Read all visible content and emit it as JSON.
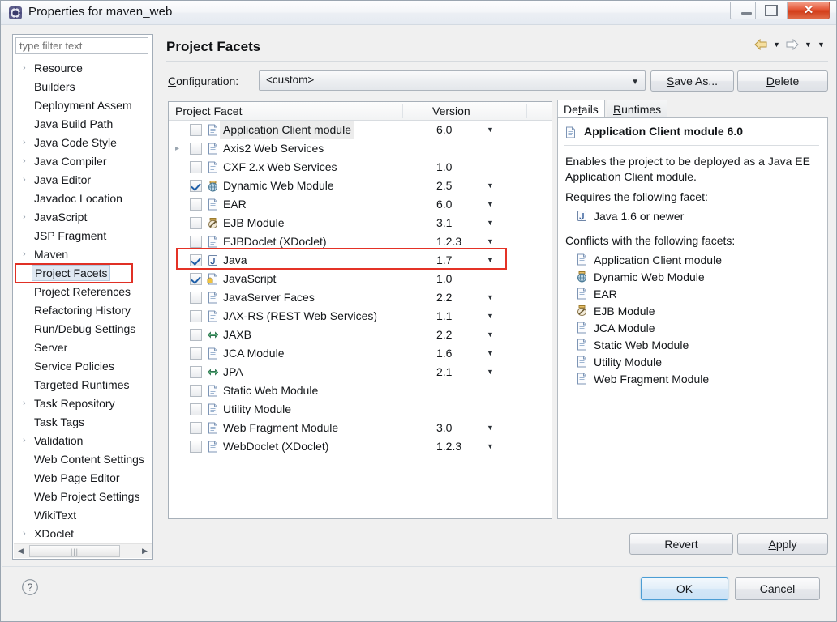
{
  "window": {
    "title": "Properties for maven_web",
    "icon": "eclipse-properties-icon",
    "controls": {
      "minimize": "–",
      "maximize": "□",
      "close": "✕"
    }
  },
  "sidebar": {
    "filter_placeholder": "type filter text",
    "filter_value": "",
    "selected": "Project Facets",
    "items": [
      {
        "label": "Resource",
        "expandable": true
      },
      {
        "label": "Builders",
        "expandable": false
      },
      {
        "label": "Deployment Assem",
        "expandable": false
      },
      {
        "label": "Java Build Path",
        "expandable": false
      },
      {
        "label": "Java Code Style",
        "expandable": true
      },
      {
        "label": "Java Compiler",
        "expandable": true
      },
      {
        "label": "Java Editor",
        "expandable": true
      },
      {
        "label": "Javadoc Location",
        "expandable": false
      },
      {
        "label": "JavaScript",
        "expandable": true
      },
      {
        "label": "JSP Fragment",
        "expandable": false
      },
      {
        "label": "Maven",
        "expandable": true
      },
      {
        "label": "Project Facets",
        "expandable": false
      },
      {
        "label": "Project References",
        "expandable": false
      },
      {
        "label": "Refactoring History",
        "expandable": false
      },
      {
        "label": "Run/Debug Settings",
        "expandable": false
      },
      {
        "label": "Server",
        "expandable": false
      },
      {
        "label": "Service Policies",
        "expandable": false
      },
      {
        "label": "Targeted Runtimes",
        "expandable": false
      },
      {
        "label": "Task Repository",
        "expandable": true
      },
      {
        "label": "Task Tags",
        "expandable": false
      },
      {
        "label": "Validation",
        "expandable": true
      },
      {
        "label": "Web Content Settings",
        "expandable": false
      },
      {
        "label": "Web Page Editor",
        "expandable": false
      },
      {
        "label": "Web Project Settings",
        "expandable": false
      },
      {
        "label": "WikiText",
        "expandable": false
      },
      {
        "label": "XDoclet",
        "expandable": true
      }
    ]
  },
  "page": {
    "title": "Project Facets",
    "nav": {
      "back_icon": "back-arrow-icon",
      "back_menu_icon": "chevron-down-icon",
      "forward_icon": "forward-arrow-icon",
      "forward_menu_icon": "chevron-down-icon",
      "menu_icon": "chevron-down-icon"
    }
  },
  "configuration": {
    "label": "Configuration:",
    "label_mnemonic": "C",
    "value": "<custom>",
    "dropdown_icon": "chevron-down-icon",
    "save_as_label": "Save As...",
    "save_as_mnemonic": "S",
    "delete_label": "Delete",
    "delete_mnemonic": "D"
  },
  "facets_table": {
    "columns": [
      "Project Facet",
      "Version"
    ],
    "rows": [
      {
        "name": "Application Client module",
        "version": "6.0",
        "checked": false,
        "has_dropdown": true,
        "expandable": false,
        "highlighted": true,
        "icon": "document-icon"
      },
      {
        "name": "Axis2 Web Services",
        "version": "",
        "checked": false,
        "has_dropdown": false,
        "expandable": true,
        "highlighted": false,
        "icon": "document-icon"
      },
      {
        "name": "CXF 2.x Web Services",
        "version": "1.0",
        "checked": false,
        "has_dropdown": false,
        "expandable": false,
        "highlighted": false,
        "icon": "document-icon"
      },
      {
        "name": "Dynamic Web Module",
        "version": "2.5",
        "checked": true,
        "has_dropdown": true,
        "expandable": false,
        "highlighted": false,
        "icon": "web-module-icon"
      },
      {
        "name": "EAR",
        "version": "6.0",
        "checked": false,
        "has_dropdown": true,
        "expandable": false,
        "highlighted": false,
        "icon": "document-icon"
      },
      {
        "name": "EJB Module",
        "version": "3.1",
        "checked": false,
        "has_dropdown": true,
        "expandable": false,
        "highlighted": false,
        "icon": "ejb-module-icon"
      },
      {
        "name": "EJBDoclet (XDoclet)",
        "version": "1.2.3",
        "checked": false,
        "has_dropdown": true,
        "expandable": false,
        "highlighted": false,
        "icon": "document-icon"
      },
      {
        "name": "Java",
        "version": "1.7",
        "checked": true,
        "has_dropdown": true,
        "expandable": false,
        "highlighted": false,
        "icon": "java-icon"
      },
      {
        "name": "JavaScript",
        "version": "1.0",
        "checked": true,
        "has_dropdown": false,
        "expandable": false,
        "highlighted": false,
        "icon": "javascript-icon"
      },
      {
        "name": "JavaServer Faces",
        "version": "2.2",
        "checked": false,
        "has_dropdown": true,
        "expandable": false,
        "highlighted": false,
        "icon": "document-icon"
      },
      {
        "name": "JAX-RS (REST Web Services)",
        "version": "1.1",
        "checked": false,
        "has_dropdown": true,
        "expandable": false,
        "highlighted": false,
        "icon": "document-icon"
      },
      {
        "name": "JAXB",
        "version": "2.2",
        "checked": false,
        "has_dropdown": true,
        "expandable": false,
        "highlighted": false,
        "icon": "jaxb-icon"
      },
      {
        "name": "JCA Module",
        "version": "1.6",
        "checked": false,
        "has_dropdown": true,
        "expandable": false,
        "highlighted": false,
        "icon": "document-icon"
      },
      {
        "name": "JPA",
        "version": "2.1",
        "checked": false,
        "has_dropdown": true,
        "expandable": false,
        "highlighted": false,
        "icon": "jpa-icon"
      },
      {
        "name": "Static Web Module",
        "version": "",
        "checked": false,
        "has_dropdown": false,
        "expandable": false,
        "highlighted": false,
        "icon": "document-icon"
      },
      {
        "name": "Utility Module",
        "version": "",
        "checked": false,
        "has_dropdown": false,
        "expandable": false,
        "highlighted": false,
        "icon": "document-icon"
      },
      {
        "name": "Web Fragment Module",
        "version": "3.0",
        "checked": false,
        "has_dropdown": true,
        "expandable": false,
        "highlighted": false,
        "icon": "document-icon"
      },
      {
        "name": "WebDoclet (XDoclet)",
        "version": "1.2.3",
        "checked": false,
        "has_dropdown": true,
        "expandable": false,
        "highlighted": false,
        "icon": "document-icon"
      }
    ]
  },
  "details": {
    "tabs": [
      {
        "label": "Details",
        "mnemonic": "t",
        "active": true
      },
      {
        "label": "Runtimes",
        "mnemonic": "R",
        "active": false
      }
    ],
    "header": "Application Client module 6.0",
    "header_icon": "document-icon",
    "description": "Enables the project to be deployed as a Java EE Application Client module.",
    "requires_label": "Requires the following facet:",
    "requires": [
      {
        "label": "Java 1.6 or newer",
        "icon": "java-icon"
      }
    ],
    "conflicts_label": "Conflicts with the following facets:",
    "conflicts": [
      {
        "label": "Application Client module",
        "icon": "document-icon"
      },
      {
        "label": "Dynamic Web Module",
        "icon": "web-module-icon"
      },
      {
        "label": "EAR",
        "icon": "document-icon"
      },
      {
        "label": "EJB Module",
        "icon": "ejb-module-icon"
      },
      {
        "label": "JCA Module",
        "icon": "document-icon"
      },
      {
        "label": "Static Web Module",
        "icon": "document-icon"
      },
      {
        "label": "Utility Module",
        "icon": "document-icon"
      },
      {
        "label": "Web Fragment Module",
        "icon": "document-icon"
      }
    ]
  },
  "buttons": {
    "revert": "Revert",
    "apply": "Apply",
    "apply_mnemonic": "A",
    "ok": "OK",
    "cancel": "Cancel",
    "help_icon": "help-question-icon"
  },
  "annotations": {
    "highlight_color": "#e43226",
    "sidebar_highlight_target": "Project Facets",
    "table_highlight_target": "Java"
  }
}
